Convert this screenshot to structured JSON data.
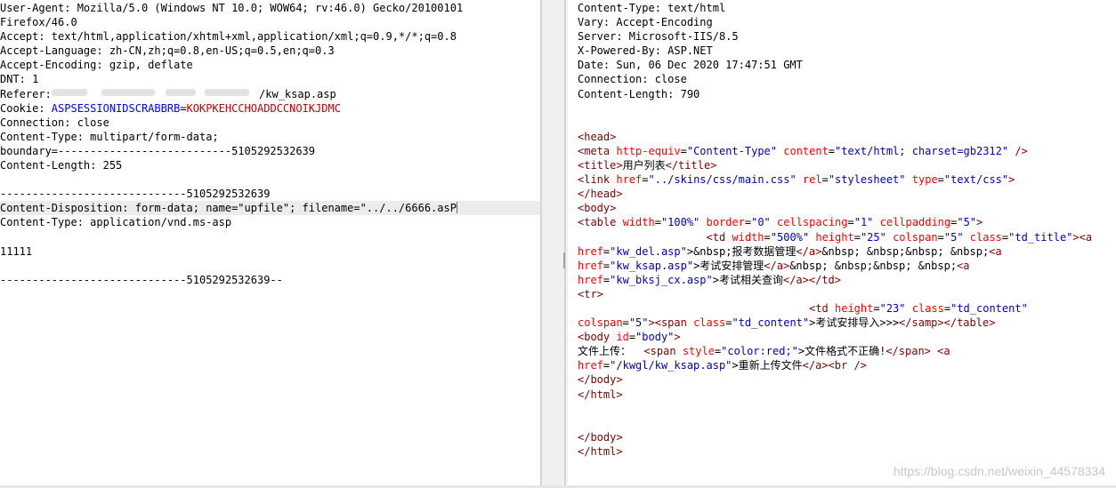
{
  "request": {
    "lines": [
      "User-Agent: Mozilla/5.0 (Windows NT 10.0; WOW64; rv:46.0) Gecko/20100101",
      "Firefox/46.0",
      "Accept: text/html,application/xhtml+xml,application/xml;q=0.9,*/*;q=0.8",
      "Accept-Language: zh-CN,zh;q=0.8,en-US;q=0.5,en;q=0.3",
      "Accept-Encoding: gzip, deflate",
      "DNT: 1"
    ],
    "referer_label": "Referer: ",
    "referer_tail": "/kw_ksap.asp",
    "cookie_label": "Cookie: ",
    "cookie_name": "ASPSESSIONIDSCRABBRB",
    "cookie_eq": "=",
    "cookie_value": "KOKPKEHCCHOADDCCNOIKJDMC",
    "lines2": [
      "Connection: close",
      "Content-Type: multipart/form-data;",
      "boundary=---------------------------5105292532639",
      "Content-Length: 255",
      "",
      "-----------------------------5105292532639"
    ],
    "disposition": "Content-Disposition: form-data; name=\"upfile\"; filename=\"../../6666.asP",
    "lines3": [
      "Content-Type: application/vnd.ms-asp",
      "",
      "11111",
      "",
      "-----------------------------5105292532639--"
    ]
  },
  "response": {
    "headers": [
      "Content-Type: text/html",
      "Vary: Accept-Encoding",
      "Server: Microsoft-IIS/8.5",
      "X-Powered-By: ASP.NET",
      "Date: Sun, 06 Dec 2020 17:47:51 GMT",
      "Connection: close",
      "Content-Length: 790"
    ],
    "html": {
      "l1": "<head>",
      "l2a": "<meta ",
      "l2b": "http-equiv",
      "l2c": "=",
      "l2d": "\"Content-Type\"",
      "l2e": " content",
      "l2f": "=",
      "l2g": "\"text/html; charset=gb2312\"",
      "l2h": " />",
      "l3a": "<title>",
      "l3b": "用户列表",
      "l3c": "</title>",
      "l4a": "<link ",
      "l4b": "href",
      "l4c": "=",
      "l4d": "\"../skins/css/main.css\"",
      "l4e": " rel",
      "l4f": "=",
      "l4g": "\"stylesheet\"",
      "l4h": " type",
      "l4i": "=",
      "l4j": "\"text/css\"",
      "l4k": ">",
      "l5": "</head>",
      "l6": "<body>",
      "l7a": "<table ",
      "l7b": "width",
      "l7c": "=",
      "l7d": "\"100%\"",
      "l7e": " border",
      "l7f": "=",
      "l7g": "\"0\"",
      "l7h": " cellspacing",
      "l7i": "=",
      "l7j": "\"1\"",
      "l7k": " cellpadding",
      "l7l": "=",
      "l7m": "\"5\"",
      "l7n": ">",
      "l8indent": "                    ",
      "l8a": "<td ",
      "l8b": "width",
      "l8c": "=",
      "l8d": "\"500%\"",
      "l8e": " height",
      "l8f": "=",
      "l8g": "\"25\"",
      "l8h": " colspan",
      "l8i": "=",
      "l8j": "\"5\"",
      "l8k": " class",
      "l8l": "=",
      "l8m": "\"td_title\"",
      "l8n": "><a",
      "l9a": "href",
      "l9b": "=",
      "l9c": "\"kw_del.asp\"",
      "l9d": ">&nbsp;报考数据管理",
      "l9e": "</a>",
      "l9f": "&nbsp; &nbsp;&nbsp; &nbsp;",
      "l9g": "<a",
      "l10a": "href",
      "l10b": "=",
      "l10c": "\"kw_ksap.asp\"",
      "l10d": ">考试安排管理",
      "l10e": "</a>",
      "l10f": "&nbsp; &nbsp;&nbsp; &nbsp;",
      "l10g": "<a",
      "l11a": "href",
      "l11b": "=",
      "l11c": "\"kw_bksj_cx.asp\"",
      "l11d": ">考试相关查询",
      "l11e": "</a></td>",
      "l12": "<tr>",
      "l13indent": "                                    ",
      "l13a": "<td ",
      "l13b": "height",
      "l13c": "=",
      "l13d": "\"23\"",
      "l13e": " class",
      "l13f": "=",
      "l13g": "\"td_content\"",
      "l14a": "colspan",
      "l14b": "=",
      "l14c": "\"5\"",
      "l14d": "><span ",
      "l14e": "class",
      "l14f": "=",
      "l14g": "\"td_content\"",
      "l14h": ">考试安排导入>>>",
      "l14i": "</samp></table>",
      "l15a": "<body ",
      "l15b": "id",
      "l15c": "=",
      "l15d": "\"body\"",
      "l15e": ">",
      "l16a": "文件上传：  ",
      "l16b": "<span ",
      "l16c": "style",
      "l16d": "=",
      "l16e": "\"color:red;\"",
      "l16f": ">文件格式不正确!",
      "l16g": "</span>",
      "l16h": " <a",
      "l17a": "href",
      "l17b": "=",
      "l17c": "\"/kwgl/kw_ksap.asp\"",
      "l17d": ">重新上传文件",
      "l17e": "</a><br />",
      "l18": "</body>",
      "l19": "</html>",
      "l20": "</body>",
      "l21": "</html>"
    }
  },
  "watermark": "https://blog.csdn.net/weixin_44578334",
  "colors": {
    "cookie_name": "#0000ff",
    "cookie_value": "#c00000",
    "tag": "#800000",
    "attr": "#ff0000",
    "attr_value": "#0000c0",
    "caret": "#e8362a"
  }
}
